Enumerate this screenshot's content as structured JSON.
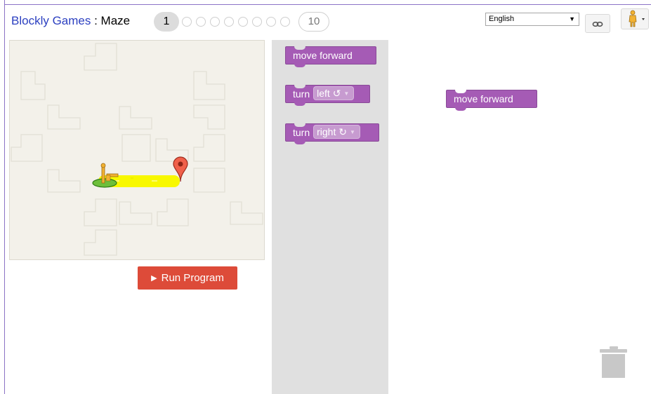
{
  "header": {
    "app_link": "Blockly Games",
    "separator": " : ",
    "game_title": "Maze",
    "current_level": "1",
    "last_level": "10"
  },
  "language": {
    "selected": "English"
  },
  "run_button": {
    "label": "Run Program"
  },
  "toolbox": {
    "blocks": [
      {
        "label": "move forward"
      },
      {
        "label": "turn",
        "field": "left ↺"
      },
      {
        "label": "turn",
        "field": "right ↻"
      }
    ]
  },
  "workspace": {
    "blocks": [
      {
        "label": "move forward"
      }
    ]
  },
  "colors": {
    "block": "#a55bb5",
    "run_button": "#dd4b39",
    "link": "#2b3fc0",
    "path": "#f8f800"
  }
}
